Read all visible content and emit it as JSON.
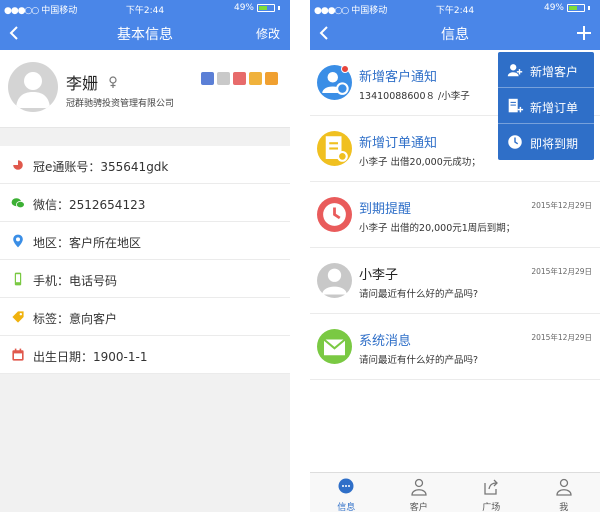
{
  "status_bar": {
    "left": {
      "signal": "●●●○○",
      "carrier": "中国移动",
      "time": "下午2:44",
      "battery": "49%"
    },
    "right": {
      "signal": "●●●○○",
      "carrier": "中国移动",
      "time": "下午2:44",
      "battery": "49%"
    },
    "battery_level": 0.49
  },
  "left_screen": {
    "nav": {
      "title": "基本信息",
      "action": "修改"
    },
    "profile": {
      "name": "李姗",
      "company": "冠群驰骋投资管理有限公司",
      "badge_colors": [
        "#5b7fd6",
        "#c9c9c9",
        "#e76b6b",
        "#f0b23c",
        "#f0a030"
      ]
    },
    "details": [
      {
        "text": "冠e通账号：355641gdk",
        "icon": "account-icon",
        "color": "#e0584c"
      },
      {
        "text": "微信：2512654123",
        "icon": "wechat-icon",
        "color": "#3cb034"
      },
      {
        "text": "地区：客户所在地区",
        "icon": "location-icon",
        "color": "#3a8ee6"
      },
      {
        "text": "手机：电话号码",
        "icon": "phone-icon",
        "color": "#7ac943"
      },
      {
        "text": "标签：意向客户",
        "icon": "tag-icon",
        "color": "#f0b20e"
      },
      {
        "text": "出生日期：1900-1-1",
        "icon": "calendar-icon",
        "color": "#e0584c"
      }
    ]
  },
  "right_screen": {
    "nav": {
      "title": "信息"
    },
    "messages": [
      {
        "title": "新增客户通知",
        "sub": "13410088600８ /小李子",
        "date": "",
        "icon": "new-customer-icon",
        "color": "#3a8ee6",
        "unread": true,
        "title_dark": false
      },
      {
        "title": "新增订单通知",
        "sub": "小李子 出借20,000元成功；",
        "date": "",
        "icon": "new-order-icon",
        "color": "#f0c020",
        "unread": false,
        "title_dark": false
      },
      {
        "title": "到期提醒",
        "sub": "小李子 出借的20,000元1周后到期；",
        "date": "2015年12月29日",
        "icon": "clock-icon",
        "color": "#e95b5b",
        "unread": false,
        "title_dark": false
      },
      {
        "title": "小李子",
        "sub": "请问最近有什么好的产品吗?",
        "date": "2015年12月29日",
        "icon": "user-avatar-icon",
        "color": "#c8c8c8",
        "unread": false,
        "title_dark": true
      },
      {
        "title": "系统消息",
        "sub": "请问最近有什么好的产品吗?",
        "date": "2015年12月29日",
        "icon": "mail-icon",
        "color": "#7ac943",
        "unread": false,
        "title_dark": false
      }
    ],
    "dropdown": [
      {
        "label": "新增客户",
        "icon": "add-customer-icon"
      },
      {
        "label": "新增订单",
        "icon": "add-order-icon"
      },
      {
        "label": "即将到期",
        "icon": "due-soon-icon"
      }
    ],
    "tabs": [
      {
        "label": "信息",
        "icon": "chat-bubble-icon",
        "active": true
      },
      {
        "label": "客户",
        "icon": "customer-icon",
        "active": false
      },
      {
        "label": "广场",
        "icon": "share-icon",
        "active": false
      },
      {
        "label": "我",
        "icon": "me-icon",
        "active": false
      }
    ]
  },
  "colors": {
    "primary": "#4a86e8",
    "accent": "#2f6fc8"
  }
}
